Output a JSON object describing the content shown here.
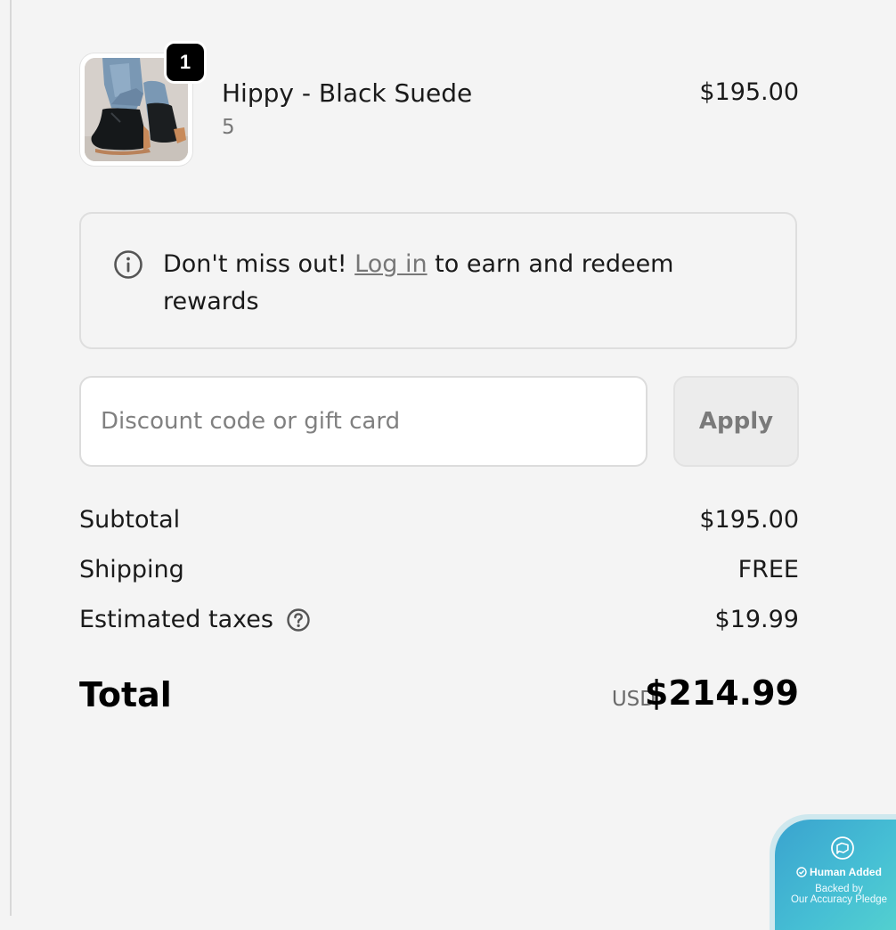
{
  "line_item": {
    "quantity": "1",
    "name": "Hippy - Black Suede",
    "variant": "5",
    "price": "$195.00",
    "image_icon": "product-photo-black-suede-ankle-boots"
  },
  "rewards_notice": {
    "icon": "info-icon",
    "lead": "Don't miss out! ",
    "link": "Log in",
    "trail": " to earn and redeem rewards"
  },
  "discount": {
    "placeholder": "Discount code or gift card",
    "value": "",
    "apply_label": "Apply"
  },
  "summary": {
    "subtotal_label": "Subtotal",
    "subtotal_value": "$195.00",
    "shipping_label": "Shipping",
    "shipping_value": "FREE",
    "taxes_label": "Estimated taxes",
    "taxes_value": "$19.99",
    "total_label": "Total",
    "currency": "USD",
    "total_value": "$214.99"
  },
  "pledge_badge": {
    "title": "Human Added",
    "line1": "Backed by",
    "line2": "Our Accuracy Pledge"
  },
  "colors": {
    "background": "#f4f4f4",
    "text": "#1a1a1a",
    "muted": "#777777",
    "badge": "#000000",
    "pledge_gradient_start": "#3aa3cf",
    "pledge_gradient_end": "#55d3cf"
  }
}
